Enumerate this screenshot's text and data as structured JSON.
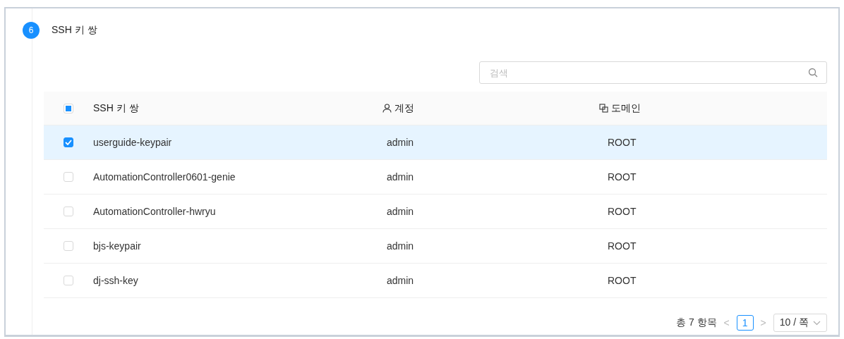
{
  "step": {
    "number": "6",
    "title": "SSH 키 쌍"
  },
  "search": {
    "placeholder": "검색"
  },
  "table": {
    "select_all": {
      "indeterminate": true
    },
    "columns": [
      {
        "label": "SSH 키 쌍",
        "kind": "plain"
      },
      {
        "label": "계정",
        "kind": "user"
      },
      {
        "label": "도메인",
        "kind": "domain"
      }
    ],
    "rows": [
      {
        "name": "userguide-keypair",
        "account": "admin",
        "domain": "ROOT",
        "selected": true
      },
      {
        "name": "AutomationController0601-genie",
        "account": "admin",
        "domain": "ROOT",
        "selected": false
      },
      {
        "name": "AutomationController-hwryu",
        "account": "admin",
        "domain": "ROOT",
        "selected": false
      },
      {
        "name": "bjs-keypair",
        "account": "admin",
        "domain": "ROOT",
        "selected": false
      },
      {
        "name": "dj-ssh-key",
        "account": "admin",
        "domain": "ROOT",
        "selected": false
      }
    ]
  },
  "pagination": {
    "total": "총 7 항목",
    "prev": "<",
    "pages": [
      {
        "label": "1",
        "selected": true
      }
    ],
    "next": ">",
    "page_size": "10 / 쪽"
  }
}
